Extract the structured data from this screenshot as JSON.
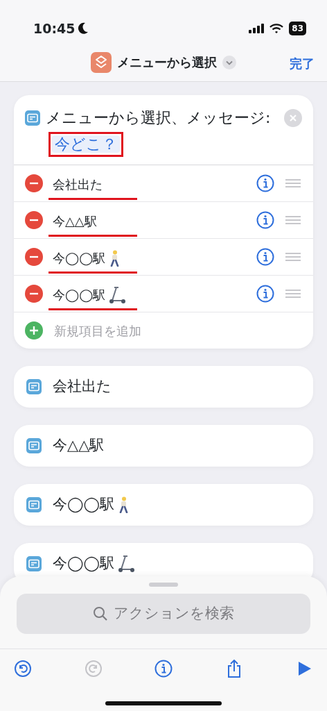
{
  "status_bar": {
    "time": "10:45",
    "battery": "83"
  },
  "nav": {
    "title": "メニューから選択",
    "done": "完了"
  },
  "menu_action": {
    "title": "メニューから選択、メッセージ:",
    "prompt": "今どこ？",
    "prompt_annotated": true,
    "items": [
      {
        "label": "会社出た",
        "kind": "plain",
        "annotated": true
      },
      {
        "label": "今△△駅",
        "kind": "plain",
        "annotated": true
      },
      {
        "label": "今◯◯駅",
        "kind": "walker",
        "annotated": true
      },
      {
        "label": "今◯◯駅",
        "kind": "scooter",
        "annotated": true
      }
    ],
    "add_label": "新規項目を追加"
  },
  "cases": [
    {
      "label": "会社出た",
      "kind": "plain"
    },
    {
      "label": "今△△駅",
      "kind": "plain"
    },
    {
      "label": "今◯◯駅",
      "kind": "walker"
    },
    {
      "label": "今◯◯駅",
      "kind": "scooter"
    }
  ],
  "search": {
    "placeholder": "アクションを検索"
  },
  "toolbar": [
    {
      "kind": "undo",
      "disabled": false
    },
    {
      "kind": "redo",
      "disabled": true
    },
    {
      "kind": "info",
      "disabled": false
    },
    {
      "kind": "share",
      "disabled": false
    },
    {
      "kind": "run",
      "disabled": false
    }
  ]
}
